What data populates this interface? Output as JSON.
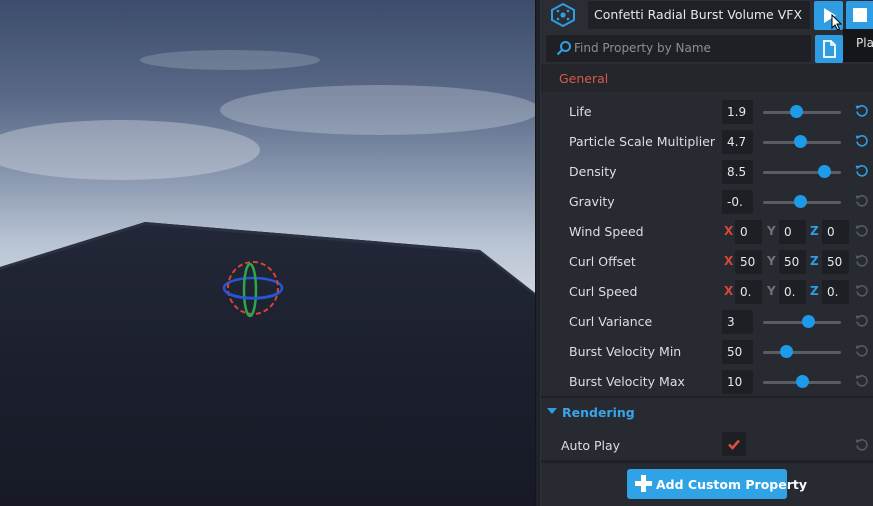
{
  "header": {
    "title": "Confetti Radial Burst Volume VFX",
    "search_placeholder": "Find Property by Name",
    "tooltip": "Play"
  },
  "general": {
    "section_label": "General",
    "rows": [
      {
        "label": "Life",
        "value": "1.9",
        "slider": 0.42,
        "reset_active": true
      },
      {
        "label": "Particle Scale Multiplier",
        "value": "4.7",
        "slider": 0.47,
        "reset_active": true
      },
      {
        "label": "Density",
        "value": "8.5",
        "slider": 0.78,
        "reset_active": true
      },
      {
        "label": "Gravity",
        "value": "-0.",
        "slider": 0.47,
        "reset_active": false
      }
    ],
    "vector_rows": [
      {
        "label": "Wind Speed",
        "x": "0",
        "y": "0",
        "z": "0"
      },
      {
        "label": "Curl Offset",
        "x": "50",
        "y": "50",
        "z": "50"
      },
      {
        "label": "Curl Speed",
        "x": "0.",
        "y": "0.",
        "z": "0."
      }
    ],
    "rows2": [
      {
        "label": "Curl Variance",
        "value": "3",
        "slider": 0.58,
        "reset_active": false
      },
      {
        "label": "Burst Velocity Min",
        "value": "50",
        "slider": 0.3,
        "reset_active": false
      },
      {
        "label": "Burst Velocity Max",
        "value": "10",
        "slider": 0.5,
        "reset_active": false
      }
    ],
    "axis_labels": {
      "x": "X",
      "y": "Y",
      "z": "Z"
    }
  },
  "rendering": {
    "section_label": "Rendering",
    "auto_play_label": "Auto Play",
    "auto_play_checked": true
  },
  "footer": {
    "add_button": "Add Custom Property"
  },
  "colors": {
    "accent": "#2f9de3",
    "general_header": "#d85a4a",
    "axis_x": "#d9473a",
    "axis_z": "#2f9de3"
  }
}
